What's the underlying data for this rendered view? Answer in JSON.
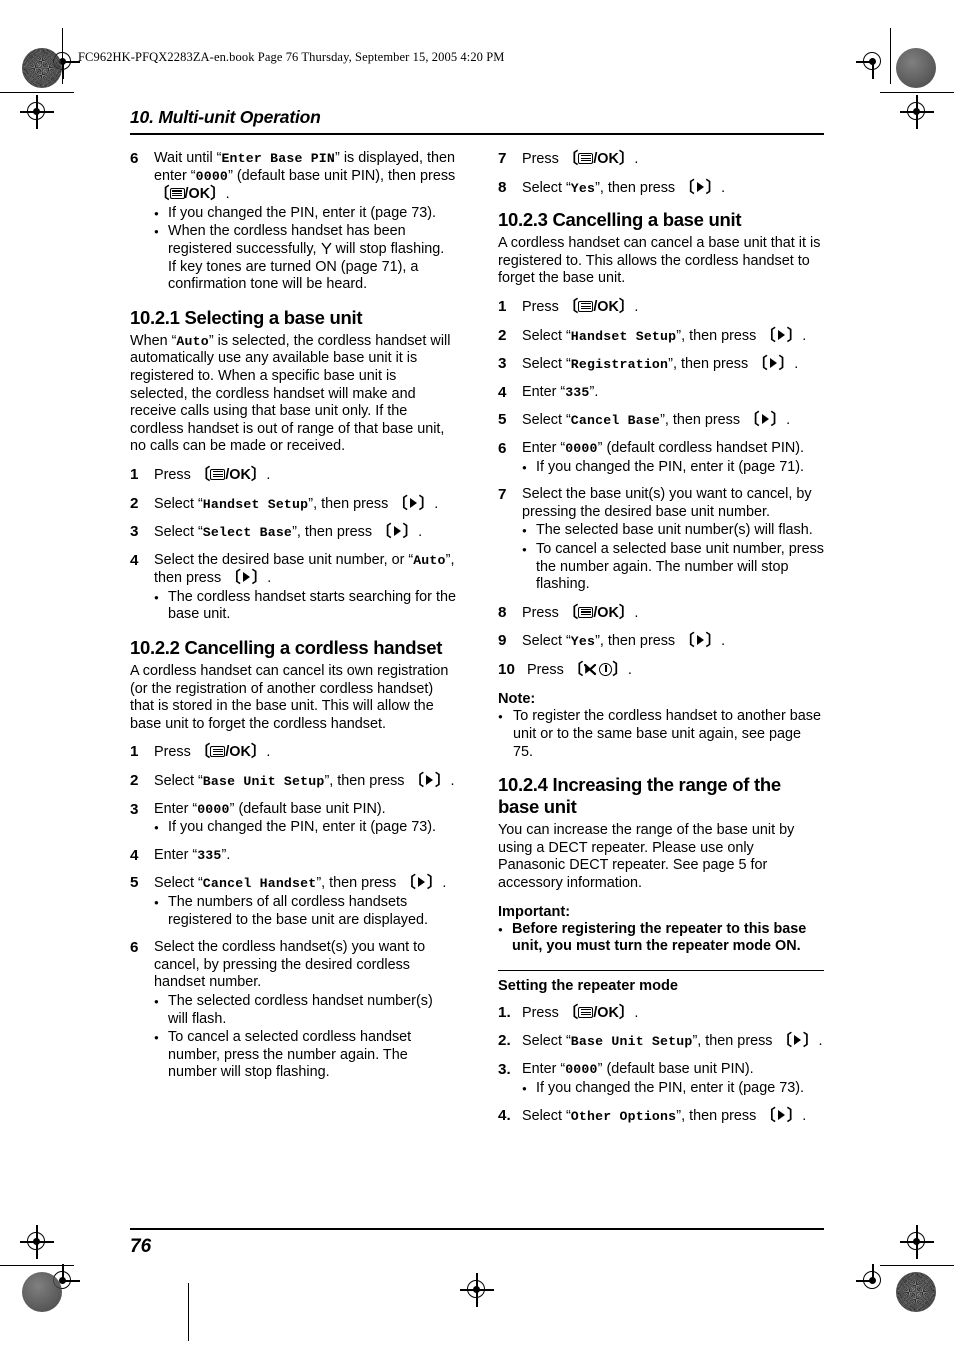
{
  "print_header": "FC962HK-PFQX2283ZA-en.book  Page 76  Thursday, September 15, 2005  4:20 PM",
  "chapter_title": "10. Multi-unit Operation",
  "page_number": "76",
  "keys": {
    "menu_ok": "/OK",
    "bracket_open": "〔",
    "bracket_close": "〕"
  },
  "left_column": {
    "continued_step": {
      "num": "6",
      "text_1": "Wait until “",
      "mono_1": "Enter Base PIN",
      "text_2": "” is displayed, then enter “",
      "mono_2": "0000",
      "text_3": "” (default base unit PIN), then press ",
      "text_4": ".",
      "bullets": [
        "If you changed the PIN, enter it (page 73).",
        "When the cordless handset has been registered successfully,   will stop flashing. If key tones are turned ON (page 71), a confirmation tone will be heard."
      ],
      "bullet2_part1": "When the cordless handset has been registered successfully, ",
      "bullet2_part2": " will stop flashing. If key tones are turned ON (page 71), a confirmation tone will be heard."
    },
    "section_1021": {
      "heading": "10.2.1 Selecting a base unit",
      "intro_1": "When “",
      "intro_mono": "Auto",
      "intro_2": "” is selected, the cordless handset will automatically use any available base unit it is registered to. When a specific base unit is selected, the cordless handset will make and receive calls using that base unit only. If the cordless handset is out of range of that base unit, no calls can be made or received.",
      "steps": [
        {
          "num": "1",
          "pre": "Press ",
          "post": "."
        },
        {
          "num": "2",
          "pre": "Select “",
          "mono": "Handset Setup",
          "mid": "”, then press ",
          "post": "."
        },
        {
          "num": "3",
          "pre": "Select “",
          "mono": "Select Base",
          "mid": "”, then press ",
          "post": "."
        },
        {
          "num": "4",
          "pre": "Select the desired base unit number, or “",
          "mono": "Auto",
          "mid": "”, then press ",
          "post": ".",
          "bullets": [
            "The cordless handset starts searching for the base unit."
          ]
        }
      ]
    },
    "section_1022": {
      "heading": "10.2.2 Cancelling a cordless handset",
      "intro": "A cordless handset can cancel its own registration (or the registration of another cordless handset) that is stored in the base unit. This will allow the base unit to forget the cordless handset.",
      "steps": [
        {
          "num": "1",
          "pre": "Press ",
          "post": "."
        },
        {
          "num": "2",
          "pre": "Select “",
          "mono": "Base Unit Setup",
          "mid": "”, then press ",
          "post": "."
        },
        {
          "num": "3",
          "pre": "Enter “",
          "mono": "0000",
          "mid": "” (default base unit PIN).",
          "post": "",
          "bullets": [
            "If you changed the PIN, enter it (page 73)."
          ]
        },
        {
          "num": "4",
          "pre": "Enter “",
          "mono": "335",
          "mid": "”.",
          "post": ""
        },
        {
          "num": "5",
          "pre": "Select “",
          "mono": "Cancel Handset",
          "mid": "”, then press ",
          "post": ".",
          "bullets": [
            "The numbers of all cordless handsets registered to the base unit are displayed."
          ]
        },
        {
          "num": "6",
          "pre": "Select the cordless handset(s) you want to cancel, by pressing the desired cordless handset number.",
          "post": "",
          "bullets": [
            "The selected cordless handset number(s) will flash.",
            "To cancel a selected cordless handset number, press the number again. The number will stop flashing."
          ]
        }
      ]
    }
  },
  "right_column": {
    "continued_steps": [
      {
        "num": "7",
        "pre": "Press ",
        "post": "."
      },
      {
        "num": "8",
        "pre": "Select “",
        "mono": "Yes",
        "mid": "”, then press ",
        "post": "."
      }
    ],
    "section_1023": {
      "heading": "10.2.3 Cancelling a base unit",
      "intro": "A cordless handset can cancel a base unit that it is registered to. This allows the cordless handset to forget the base unit.",
      "steps": [
        {
          "num": "1",
          "pre": "Press ",
          "post": "."
        },
        {
          "num": "2",
          "pre": "Select “",
          "mono": "Handset Setup",
          "mid": "”, then press ",
          "post": "."
        },
        {
          "num": "3",
          "pre": "Select “",
          "mono": "Registration",
          "mid": "”, then press ",
          "post": "."
        },
        {
          "num": "4",
          "pre": "Enter “",
          "mono": "335",
          "mid": "”.",
          "post": ""
        },
        {
          "num": "5",
          "pre": "Select “",
          "mono": "Cancel Base",
          "mid": "”, then press ",
          "post": "."
        },
        {
          "num": "6",
          "pre": "Enter “",
          "mono": "0000",
          "mid": "” (default cordless handset PIN).",
          "post": "",
          "bullets": [
            "If you changed the PIN, enter it (page 71)."
          ]
        },
        {
          "num": "7",
          "pre": "Select the base unit(s) you want to cancel, by pressing the desired base unit number.",
          "post": "",
          "bullets": [
            "The selected base unit number(s) will flash.",
            "To cancel a selected base unit number, press the number again. The number will stop flashing."
          ]
        },
        {
          "num": "8",
          "pre": "Press ",
          "post": "."
        },
        {
          "num": "9",
          "pre": "Select “",
          "mono": "Yes",
          "mid": "”, then press ",
          "post": "."
        },
        {
          "num": "10",
          "pre": "Press ",
          "post": ".",
          "key": "power_off"
        }
      ],
      "note_label": "Note:",
      "note_bullets": [
        "To register the cordless handset to another base unit or to the same base unit again, see page 75."
      ]
    },
    "section_1024": {
      "heading": "10.2.4 Increasing the range of the base unit",
      "intro": "You can increase the range of the base unit by using a DECT repeater. Please use only Panasonic DECT repeater. See page 5 for accessory information.",
      "important_label": "Important:",
      "important_bullets": [
        "Before registering the repeater to this base unit, you must turn the repeater mode ON."
      ],
      "sub_heading": "Setting the repeater mode",
      "steps": [
        {
          "num": "1.",
          "pre": "Press ",
          "post": "."
        },
        {
          "num": "2.",
          "pre": "Select “",
          "mono": "Base Unit Setup",
          "mid": "”, then press ",
          "post": "."
        },
        {
          "num": "3.",
          "pre": "Enter “",
          "mono": "0000",
          "mid": "” (default base unit PIN).",
          "post": "",
          "bullets": [
            "If you changed the PIN, enter it (page 73)."
          ]
        },
        {
          "num": "4.",
          "pre": "Select “",
          "mono": "Other Options",
          "mid": "”, then press ",
          "post": "."
        }
      ]
    }
  }
}
